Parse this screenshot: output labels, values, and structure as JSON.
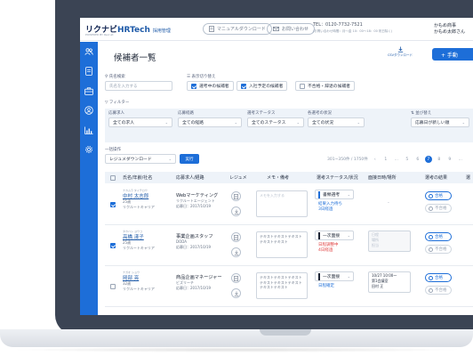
{
  "header": {
    "logo_main": "リクナビ",
    "logo_hr": "HR",
    "logo_tech": "Tech",
    "logo_admin": "採用管理",
    "logo_powered": "POWERED BY Recruit",
    "manual_download": "マニュアルダウンロード",
    "contact": "お問い合わせ",
    "tel": "TEL：0120-7732-7521",
    "tel_hours": "(お問い合わせ時間：月〜金 10：00〜18：00 祝日除く)",
    "company": "かもめ商事",
    "user": "かもめ太郎さん"
  },
  "sidebar": {
    "items": [
      {
        "icon": "people-icon"
      },
      {
        "icon": "document-icon"
      },
      {
        "icon": "briefcase-icon"
      },
      {
        "icon": "user-badge-icon"
      },
      {
        "icon": "bar-chart-icon"
      },
      {
        "icon": "gear-icon"
      }
    ]
  },
  "page": {
    "title": "候補者一覧",
    "csv_download": "CSVダウンロード",
    "new_button": "+ 手動"
  },
  "search": {
    "name_label": "氏名検索",
    "name_placeholder": "氏名を入力する",
    "display_label": "表示切り替え",
    "opts": [
      {
        "label": "選考中の候補者",
        "checked": true
      },
      {
        "label": "入社予定の候補者",
        "checked": true
      },
      {
        "label": "不合格・辞退の候補者",
        "checked": false
      }
    ]
  },
  "filter": {
    "title": "フィルター",
    "sort_label": "並び替え",
    "fields": [
      {
        "label": "応募求人",
        "value": "全ての求人"
      },
      {
        "label": "応募経路",
        "value": "全ての経路"
      },
      {
        "label": "選考ステータス",
        "value": "全てのステータス"
      },
      {
        "label": "各選考の状況",
        "value": "全ての状況"
      }
    ],
    "sort_value": "応募日が新しい順"
  },
  "bulk": {
    "label": "一括操作",
    "select_value": "レジュメダウンロード",
    "execute": "実行"
  },
  "pagination": {
    "range": "301~350件 / 1750件",
    "pages": [
      "1",
      "...",
      "5",
      "6",
      "7",
      "8",
      "9",
      "..."
    ],
    "current": "7",
    "prev": "‹",
    "next": "›"
  },
  "table": {
    "headers": [
      "氏名/年齢/社名",
      "応募求人/経路",
      "レジュメ",
      "メモ・備考",
      "選考ステータス/状況",
      "面接日時/場所",
      "選考の結果",
      "選"
    ],
    "rows": [
      {
        "checked": true,
        "kana": "ナカムラ タイチロウ",
        "name": "中村 太志郎",
        "age": "25歳",
        "company": "リクルートキャリア",
        "job": "Webマーケティング",
        "route": "リクルートエージェント",
        "applied": "応募日：2017/10/19",
        "memo": "メモを入力する",
        "memo_empty": true,
        "status": "書類選考",
        "status_color": "#1d6ed8",
        "status_lines": [
          "結果入力待ち",
          "3日経過"
        ],
        "status_text_color": "#1d6ed8",
        "interview": [
          "-"
        ],
        "interview_dim": false,
        "interview_empty": true,
        "pass": "合格",
        "fail": "不合格"
      },
      {
        "checked": true,
        "kana": "タカハシ ヨウコ",
        "name": "高橋 漾子",
        "age": "25歳",
        "company": "リクルートキャリア",
        "job": "事業企画スタッフ",
        "route": "DODA",
        "applied": "応募日：2017/10/19",
        "memo": "テキストテキストテキストテキストテキスト",
        "memo_empty": false,
        "status": "一次面接",
        "status_color": "#1d2636",
        "status_lines": [
          "日程調整中",
          "4日経過"
        ],
        "status_text_color": "#e04040",
        "interview": [
          "日程",
          "場所",
          "担当"
        ],
        "interview_dim": true,
        "interview_empty": false,
        "pass": "合格",
        "fail": "不合格"
      },
      {
        "checked": false,
        "kana": "ナガオ ショウ",
        "name": "岡部 亮",
        "age": "32歳",
        "company": "リクルートキャリア",
        "job": "商品企画マネージャー",
        "route": "ビズリーチ",
        "applied": "応募日：2017/10/19",
        "memo": "テキストテキストテキストテキストテキストテキストテキストテキスト",
        "memo_empty": false,
        "status": "一次面接",
        "status_color": "#1d2636",
        "status_lines": [
          "日程確定"
        ],
        "status_text_color": "#1d6ed8",
        "interview": [
          "10/27 10:00～",
          "第1会議室",
          "田村 正"
        ],
        "interview_dim": false,
        "interview_empty": false,
        "pass": "合格",
        "fail": "不合格"
      }
    ]
  },
  "colors": {
    "primary": "#1d6ed8",
    "navy": "#0b1f4d",
    "alert": "#e04040"
  }
}
